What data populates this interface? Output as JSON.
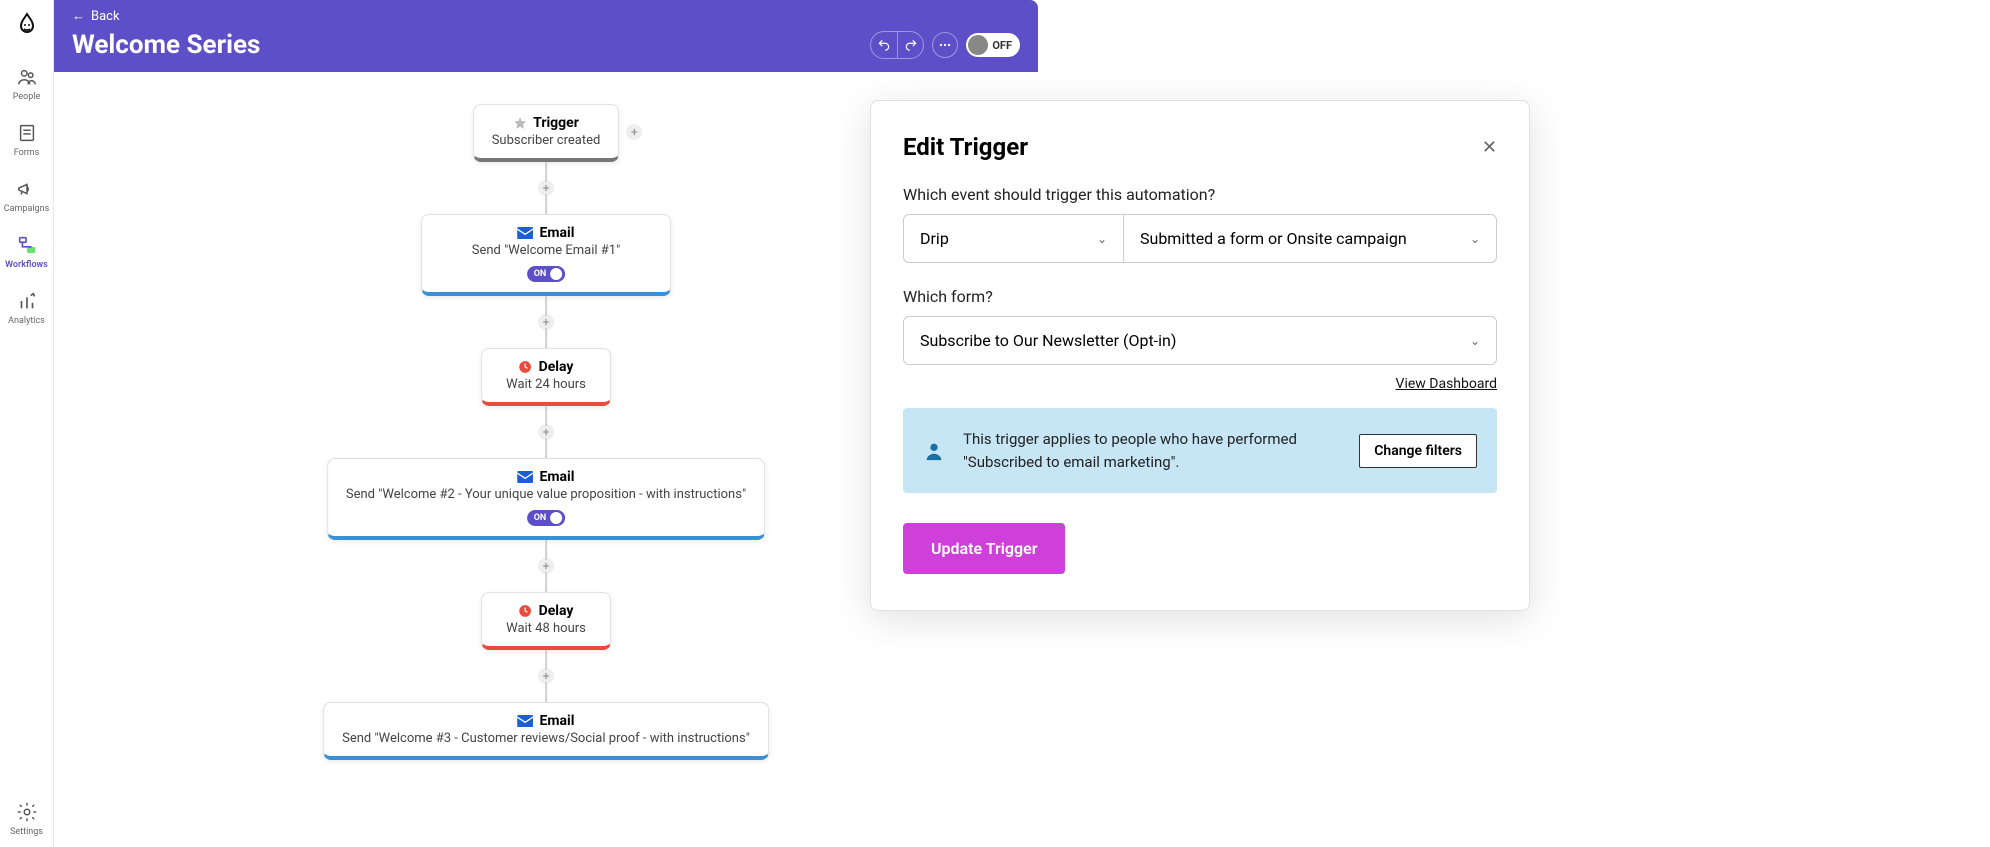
{
  "header": {
    "back": "Back",
    "title": "Welcome Series",
    "power": "OFF"
  },
  "sidebar": {
    "items": [
      {
        "label": "People"
      },
      {
        "label": "Forms"
      },
      {
        "label": "Campaigns"
      },
      {
        "label": "Workflows"
      },
      {
        "label": "Analytics"
      }
    ],
    "settings": "Settings"
  },
  "flow": {
    "trigger": {
      "title": "Trigger",
      "sub": "Subscriber created"
    },
    "email1": {
      "title": "Email",
      "sub": "Send \"Welcome Email #1\"",
      "toggle": "ON"
    },
    "delay1": {
      "title": "Delay",
      "sub": "Wait 24 hours"
    },
    "email2": {
      "title": "Email",
      "sub": "Send \"Welcome #2 - Your unique value proposition - with instructions\"",
      "toggle": "ON"
    },
    "delay2": {
      "title": "Delay",
      "sub": "Wait 48 hours"
    },
    "email3": {
      "title": "Email",
      "sub": "Send \"Welcome #3 - Customer reviews/Social proof - with instructions\""
    }
  },
  "panel": {
    "title": "Edit Trigger",
    "q1": "Which event should trigger this automation?",
    "provider": "Drip",
    "event": "Submitted a form or Onsite campaign",
    "q2": "Which form?",
    "form": "Subscribe to Our Newsletter (Opt-in)",
    "view_dashboard": "View Dashboard",
    "info": "This trigger applies to people who have performed \"Subscribed to email marketing\".",
    "change_filters": "Change filters",
    "submit": "Update Trigger"
  }
}
